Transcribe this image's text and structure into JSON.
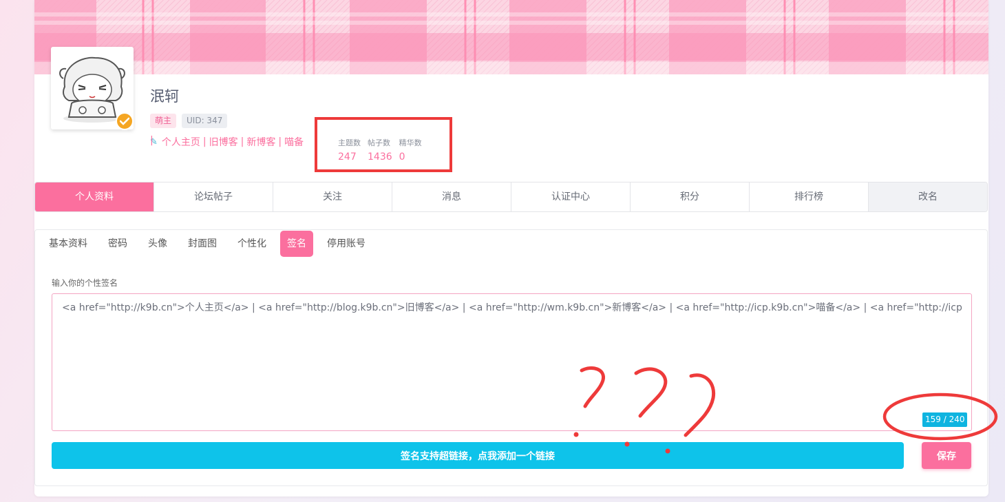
{
  "profile": {
    "username": "泯轲",
    "role_badge": "萌主",
    "uid_badge": "UID: 347",
    "links": [
      "个人主页",
      "旧博客",
      "新博客",
      "喵备"
    ],
    "link_separator": "|",
    "stats": [
      {
        "label": "主题数",
        "value": "247"
      },
      {
        "label": "帖子数",
        "value": "1436"
      },
      {
        "label": "精华数",
        "value": "0"
      }
    ]
  },
  "main_tabs": [
    "个人资料",
    "论坛帖子",
    "关注",
    "消息",
    "认证中心",
    "积分",
    "排行榜",
    "改名"
  ],
  "sub_tabs": [
    "基本资料",
    "密码",
    "头像",
    "封面图",
    "个性化",
    "签名",
    "停用账号"
  ],
  "signature": {
    "label": "输入你的个性签名",
    "value": "<a href=\"http://k9b.cn\">个人主页</a> | <a href=\"http://blog.k9b.cn\">旧博客</a> | <a href=\"http://wm.k9b.cn\">新博客</a> | <a href=\"http://icp.k9b.cn\">喵备</a> | <a href=\"http://icp",
    "counter": "159 / 240",
    "add_link_label": "签名支持超链接，点我添加一个链接",
    "save_label": "保存"
  },
  "annotation": {
    "color": "#ee3a3a",
    "scribble_marks": "???"
  },
  "colors": {
    "accent_pink": "#fb6f9e",
    "accent_blue": "#0ec3ea",
    "verified_orange": "#f5a623"
  }
}
